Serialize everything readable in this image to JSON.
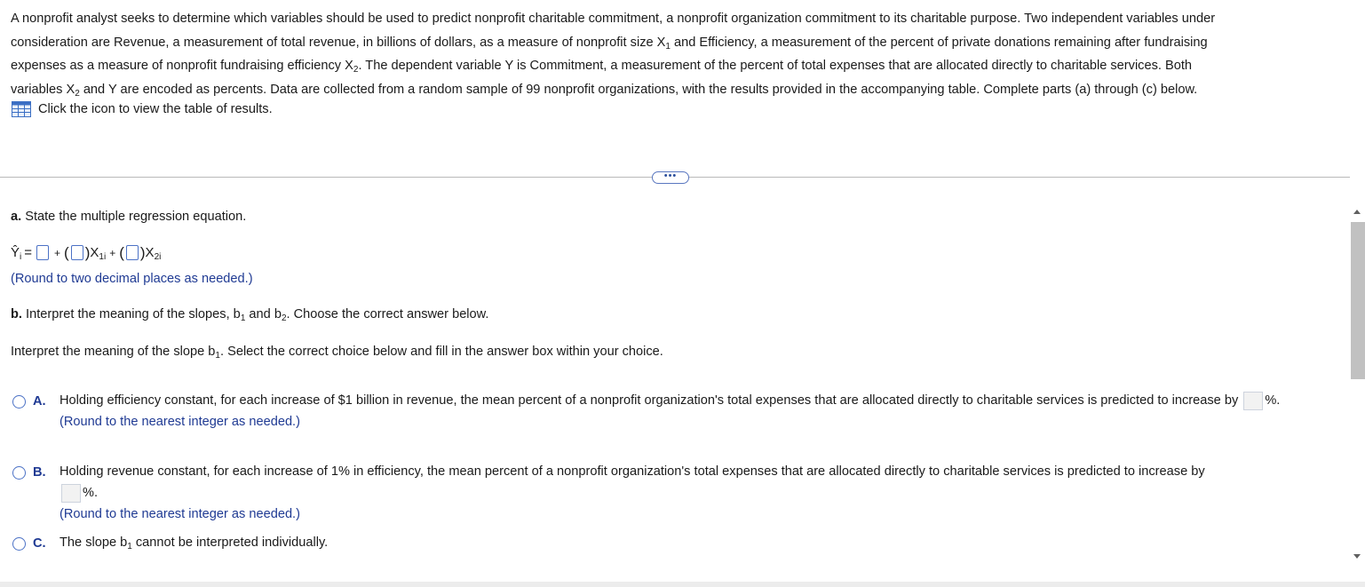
{
  "intro": {
    "line1": "A nonprofit analyst seeks to determine which variables should be used to predict nonprofit charitable commitment, a nonprofit organization commitment to its charitable purpose. Two independent variables under",
    "line2": "consideration are Revenue, a measurement of total revenue, in billions of dollars, as a measure of nonprofit size X",
    "line2_sub": "1",
    "line2_end": " and Efficiency, a measurement of the percent of private donations remaining after fundraising",
    "line3": "expenses as a measure of nonprofit fundraising efficiency X",
    "line3_sub": "2",
    "line3_end": ". The dependent variable Y is Commitment, a measurement of the percent of total expenses that are allocated directly to charitable services. Both",
    "line4": "variables X",
    "line4_sub": "2",
    "line4_end": " and Y are encoded as percents. Data are collected from a random sample of 99 nonprofit organizations, with the results provided in the accompanying table. Complete parts (a) through (c) below."
  },
  "table_link": {
    "label": "Click the icon to view the table of results.",
    "icon": "table-grid-icon"
  },
  "more_button": {
    "label": "•••"
  },
  "part_a": {
    "bold": "a.",
    "text": " State the multiple regression equation.",
    "yhat": "Ŷ",
    "yhat_sub": "i",
    "equals": "=",
    "plus": "+",
    "x1": "X",
    "x1_sub": "1i",
    "x2": "X",
    "x2_sub": "2i",
    "hint": "(Round to two decimal places as needed.)"
  },
  "part_b": {
    "bold": "b.",
    "text": " Interpret the meaning of the slopes, b",
    "sub1": "1",
    "mid": " and b",
    "sub2": "2",
    "end": ". Choose the correct answer below.",
    "q_text": "Interpret the meaning of the slope b",
    "q_sub": "1",
    "q_end": ". Select the correct choice below and fill in the answer box within your choice."
  },
  "choices": [
    {
      "letter": "A.",
      "text": "Holding efficiency constant, for each increase of $1 billion in revenue, the mean percent of a nonprofit organization's total expenses that are allocated directly to charitable services is predicted to increase by",
      "unit": "%.",
      "hint": "(Round to the nearest integer as needed.)"
    },
    {
      "letter": "B.",
      "text": "Holding revenue constant, for each increase of 1% in efficiency, the mean percent of a nonprofit organization's total expenses that are allocated directly to charitable services is predicted to increase by",
      "unit": "%.",
      "hint": "(Round to the nearest integer as needed.)"
    },
    {
      "letter": "C.",
      "text": "The slope b",
      "sub": "1",
      "end": " cannot be interpreted individually."
    }
  ],
  "colors": {
    "accent": "#1f3a93",
    "input_border": "#4c72c6",
    "answer_box_bg": "#f2f2f2"
  }
}
